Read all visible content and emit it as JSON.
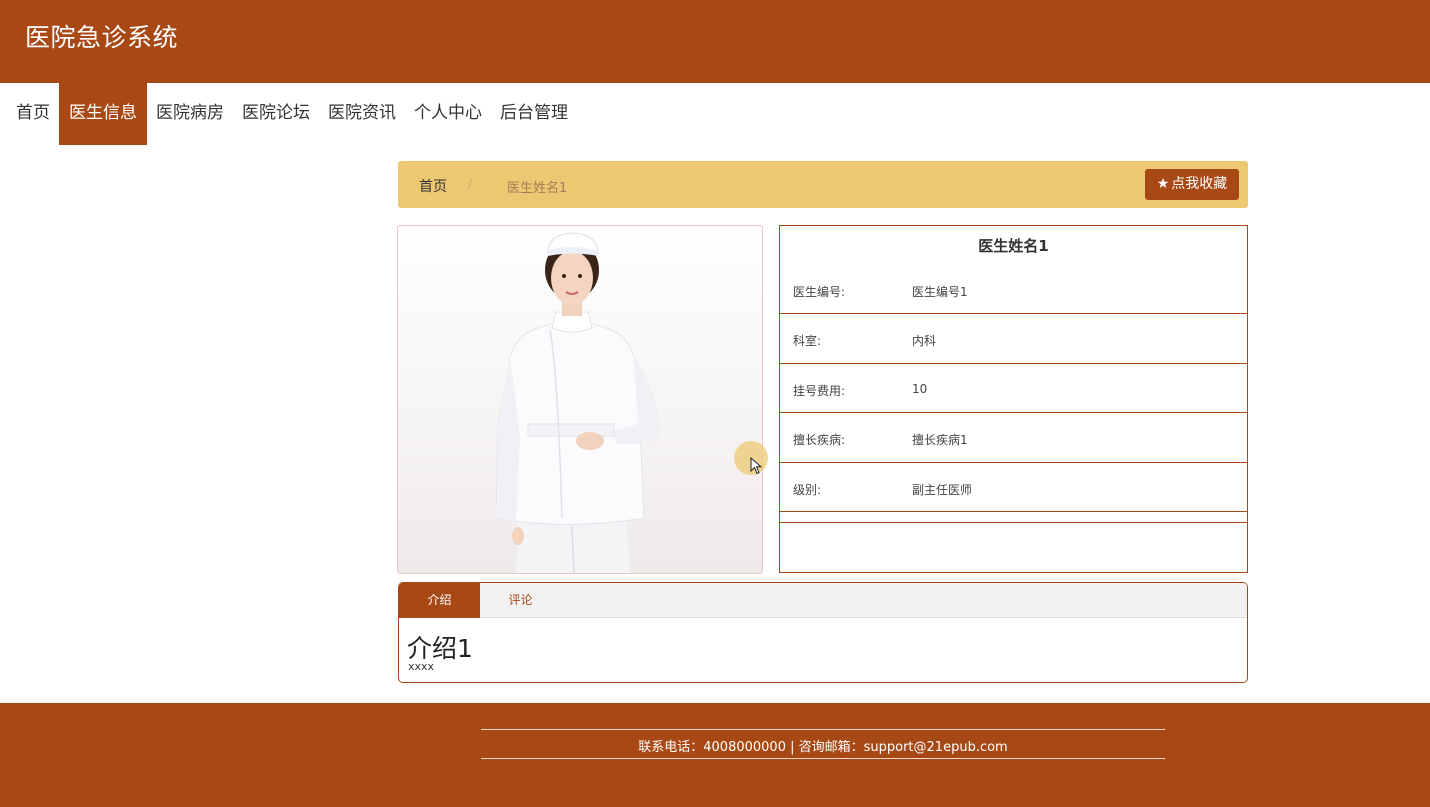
{
  "header": {
    "title": "医院急诊系统"
  },
  "nav": {
    "items": [
      {
        "label": "首页"
      },
      {
        "label": "医生信息"
      },
      {
        "label": "医院病房"
      },
      {
        "label": "医院论坛"
      },
      {
        "label": "医院资讯"
      },
      {
        "label": "个人中心"
      },
      {
        "label": "后台管理"
      }
    ],
    "active_index": 1
  },
  "breadcrumb": {
    "home": "首页",
    "separator": "/",
    "current": "医生姓名1"
  },
  "favorite_button": {
    "label": "点我收藏",
    "icon": "star-icon"
  },
  "doctor": {
    "name": "医生姓名1",
    "fields": [
      {
        "label": "医生编号:",
        "value": "医生编号1"
      },
      {
        "label": "科室:",
        "value": "内科"
      },
      {
        "label": "挂号费用:",
        "value": "10"
      },
      {
        "label": "擅长疾病:",
        "value": "擅长疾病1"
      },
      {
        "label": "级别:",
        "value": "副主任医师"
      }
    ]
  },
  "tabs": {
    "items": [
      {
        "label": "介绍"
      },
      {
        "label": "评论"
      }
    ],
    "active_index": 0
  },
  "intro": {
    "title": "介绍1",
    "body": "xxxx"
  },
  "footer": {
    "text": "联系电话：4008000000 | 咨询邮箱：support@21epub.com"
  },
  "colors": {
    "brand": "#a84915",
    "breadcrumb_bg": "#ecc872"
  }
}
